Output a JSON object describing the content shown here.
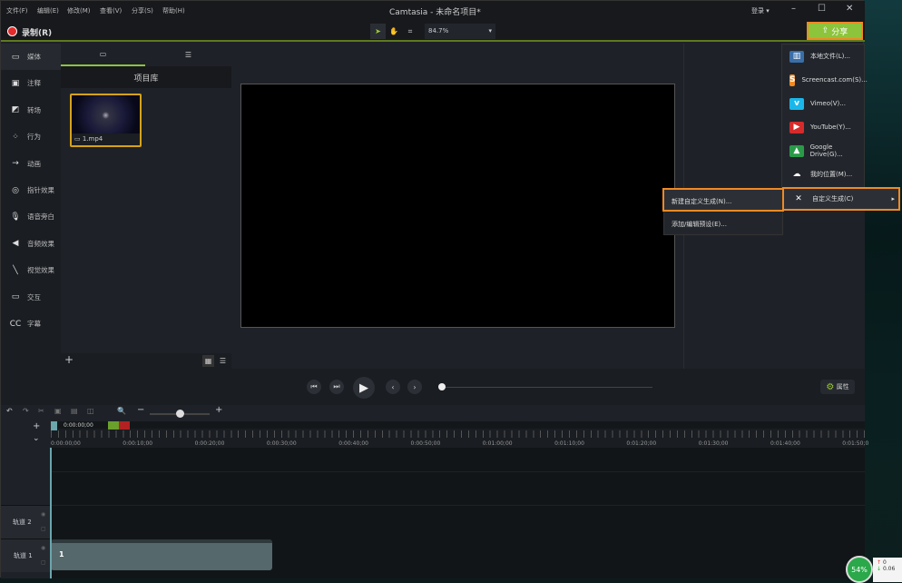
{
  "window": {
    "title": "Camtasia - 未命名项目*",
    "login": "登录 ▾"
  },
  "menu": [
    "文件(F)",
    "编辑(E)",
    "修改(M)",
    "查看(V)",
    "分享(S)",
    "帮助(H)"
  ],
  "toolbar": {
    "record": "录制(R)",
    "zoom": "84.7%",
    "share": "分享"
  },
  "sidebar": [
    {
      "icon": "media-icon",
      "glyph": "▭",
      "label": "媒体"
    },
    {
      "icon": "annotation-icon",
      "glyph": "▣",
      "label": "注释"
    },
    {
      "icon": "transition-icon",
      "glyph": "◩",
      "label": "转场"
    },
    {
      "icon": "behavior-icon",
      "glyph": "⁘",
      "label": "行为"
    },
    {
      "icon": "animation-icon",
      "glyph": "→",
      "label": "动画"
    },
    {
      "icon": "cursor-effect-icon",
      "glyph": "◎",
      "label": "指针效果"
    },
    {
      "icon": "mic-icon",
      "glyph": "🎙",
      "label": "语音旁白"
    },
    {
      "icon": "audio-effect-icon",
      "glyph": "◀",
      "label": "音频效果"
    },
    {
      "icon": "visual-effect-icon",
      "glyph": "╲",
      "label": "视觉效果"
    },
    {
      "icon": "interactive-icon",
      "glyph": "▭",
      "label": "交互"
    },
    {
      "icon": "cc-icon",
      "glyph": "CC",
      "label": "字幕"
    }
  ],
  "media": {
    "header": "项目库",
    "clip": "1.mp4"
  },
  "properties": "属性",
  "shareMenu": [
    {
      "label": "本地文件(L)...",
      "icon": "local-file-icon",
      "glyph": "▥",
      "color": "#3a6ea8"
    },
    {
      "label": "Screencast.com(S)...",
      "icon": "screencast-icon",
      "glyph": "S",
      "color": "#f08a24"
    },
    {
      "label": "Vimeo(V)...",
      "icon": "vimeo-icon",
      "glyph": "v",
      "color": "#1ab7ea"
    },
    {
      "label": "YouTube(Y)...",
      "icon": "youtube-icon",
      "glyph": "▶",
      "color": "#d62b2b"
    },
    {
      "label": "Google Drive(G)...",
      "icon": "google-drive-icon",
      "glyph": "▲",
      "color": "#2a9a48"
    },
    {
      "label": "我的位置(M)...",
      "icon": "cloud-icon",
      "glyph": "☁",
      "color": "transparent"
    },
    {
      "label": "自定义生成(C)",
      "icon": "tools-icon",
      "glyph": "✕",
      "color": "transparent"
    }
  ],
  "submenu": [
    "新建自定义生成(N)...",
    "添加/编辑预设(E)..."
  ],
  "timeline": {
    "playhead": "0:00:00;00",
    "ticks": [
      "0:00:00;00",
      "0:00:10;00",
      "0:00:20;00",
      "0:00:30;00",
      "0:00:40;00",
      "0:00:50;00",
      "0:01:00;00",
      "0:01:10;00",
      "0:01:20;00",
      "0:01:30;00",
      "0:01:40;00",
      "0:01:50;0"
    ],
    "tracks": [
      "轨道 2",
      "轨道 1"
    ],
    "clipLabel": "1"
  },
  "widget": {
    "percent": "54%",
    "up": "0",
    "down": "0.06"
  }
}
